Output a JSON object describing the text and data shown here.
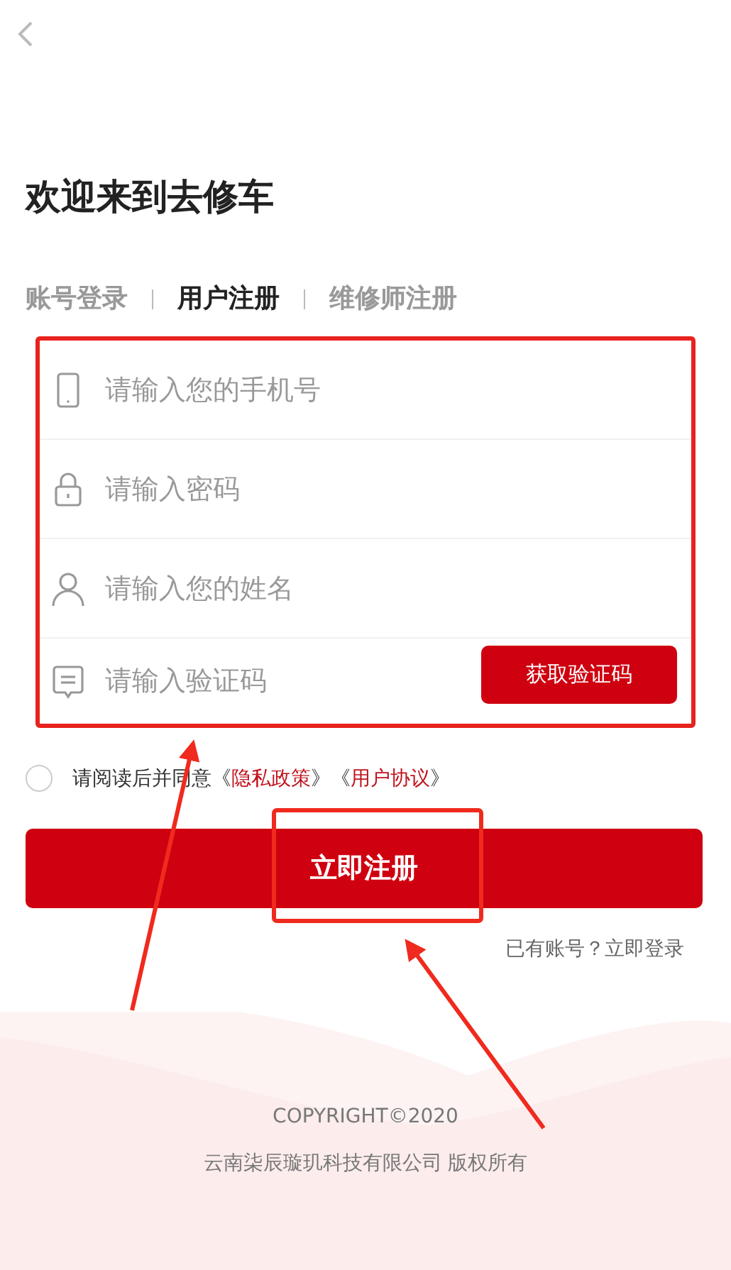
{
  "title": "欢迎来到去修车",
  "tabs": [
    {
      "label": "账号登录",
      "selected": false
    },
    {
      "label": "用户注册",
      "selected": true
    },
    {
      "label": "维修师注册",
      "selected": false
    }
  ],
  "fields": [
    {
      "kind": "phone",
      "placeholder": "请输入您的手机号"
    },
    {
      "kind": "password",
      "placeholder": "请输入密码"
    },
    {
      "kind": "name",
      "placeholder": "请输入您的姓名"
    },
    {
      "kind": "code",
      "placeholder": "请输入验证码",
      "button": "获取验证码"
    }
  ],
  "agreement": {
    "checked": false,
    "text": "请阅读后并同意",
    "links": [
      {
        "before": "《",
        "label": "隐私政策",
        "after": "》"
      },
      {
        "before": "《",
        "label": "用户协议",
        "after": "》"
      }
    ]
  },
  "submit": "立即注册",
  "login_link": "已有账号？立即登录",
  "footer": {
    "copyright": "COPYRIGHT©2020",
    "company": "云南柒辰璇玑科技有限公司 版权所有"
  }
}
